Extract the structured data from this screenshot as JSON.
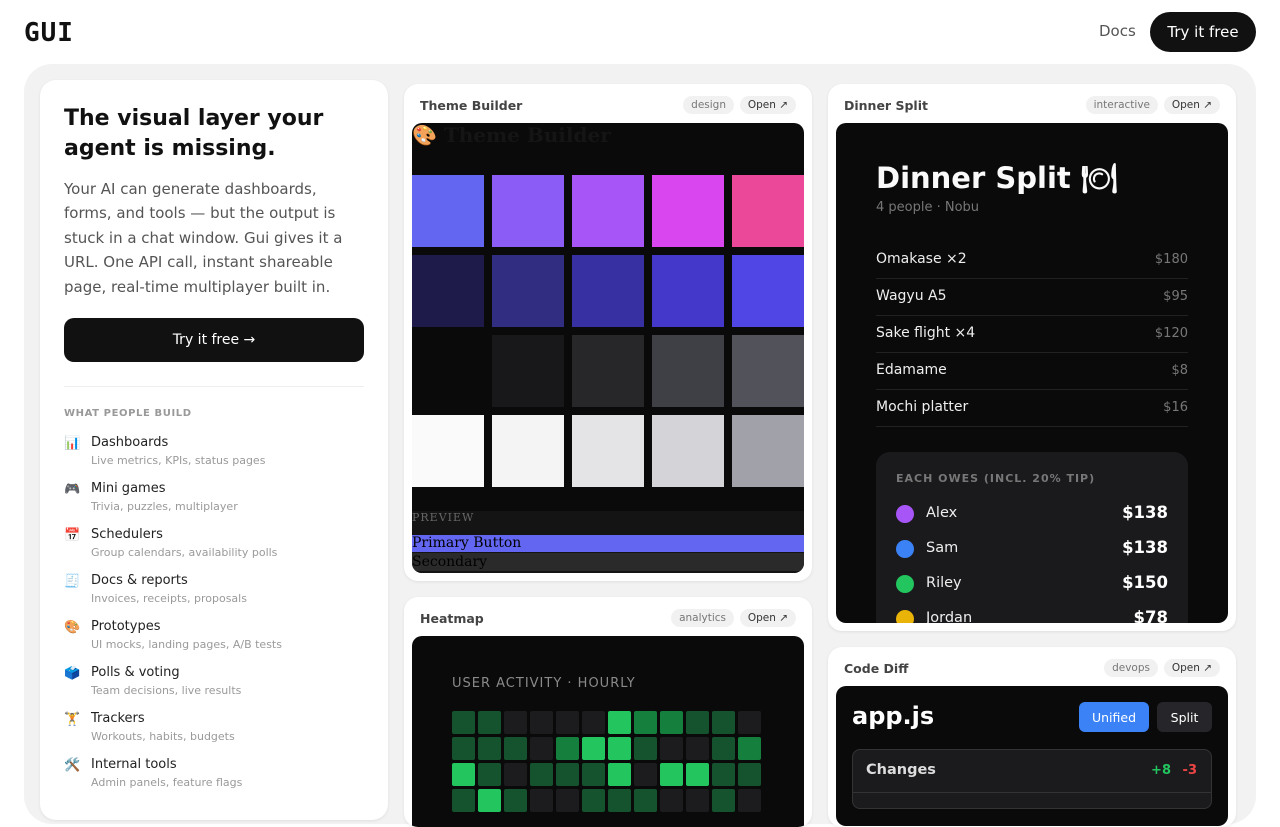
{
  "nav": {
    "logo": "GUI",
    "docs_label": "Docs",
    "try_label": "Try it free"
  },
  "hero": {
    "title": "The visual layer your agent is missing.",
    "description": "Your AI can generate dashboards, forms, and tools — but the output is stuck in a chat window. Gui gives it a URL. One API call, instant shareable page, real-time multiplayer built in.",
    "cta_label": "Try it free →",
    "build_heading": "WHAT PEOPLE BUILD",
    "items": [
      {
        "icon": "📊",
        "icon_name": "bar-chart-icon",
        "label": "Dashboards",
        "sub": "Live metrics, KPIs, status pages"
      },
      {
        "icon": "🎮",
        "icon_name": "game-controller-icon",
        "label": "Mini games",
        "sub": "Trivia, puzzles, multiplayer"
      },
      {
        "icon": "📅",
        "icon_name": "calendar-icon",
        "label": "Schedulers",
        "sub": "Group calendars, availability polls"
      },
      {
        "icon": "🧾",
        "icon_name": "receipt-icon",
        "label": "Docs & reports",
        "sub": "Invoices, receipts, proposals"
      },
      {
        "icon": "🎨",
        "icon_name": "palette-icon",
        "label": "Prototypes",
        "sub": "UI mocks, landing pages, A/B tests"
      },
      {
        "icon": "🗳️",
        "icon_name": "ballot-box-icon",
        "label": "Polls & voting",
        "sub": "Team decisions, live results"
      },
      {
        "icon": "🏋️",
        "icon_name": "weightlifter-icon",
        "label": "Trackers",
        "sub": "Workouts, habits, budgets"
      },
      {
        "icon": "🛠️",
        "icon_name": "tools-icon",
        "label": "Internal tools",
        "sub": "Admin panels, feature flags"
      }
    ]
  },
  "cards": {
    "theme": {
      "title": "Theme Builder",
      "tag": "design",
      "open_label": "Open ↗",
      "heading": "🎨 Theme Builder",
      "swatch_rows": [
        [
          "#6366f1",
          "#8b5cf6",
          "#a855f7",
          "#d946ef",
          "#ec4899"
        ],
        [
          "#1e1b4b",
          "#312e81",
          "#3730a3",
          "#4338ca",
          "#4f46e5"
        ],
        [
          "#0a0a0a",
          "#18181b",
          "#27272a",
          "#3f3f46",
          "#52525b"
        ],
        [
          "#fafafa",
          "#f4f4f5",
          "#e4e4e7",
          "#d4d4d8",
          "#a1a1aa"
        ]
      ],
      "preview_label": "PREVIEW",
      "primary_label": "Primary Button",
      "secondary_label": "Secondary"
    },
    "heatmap": {
      "title": "Heatmap",
      "tag": "analytics",
      "open_label": "Open ↗",
      "chart_title": "USER ACTIVITY · HOURLY",
      "levels": [
        [
          1,
          1,
          0,
          0,
          0,
          0,
          3,
          2,
          2,
          1,
          1,
          0
        ],
        [
          1,
          1,
          1,
          0,
          2,
          3,
          3,
          1,
          0,
          0,
          1,
          2
        ],
        [
          3,
          1,
          0,
          1,
          1,
          1,
          3,
          0,
          3,
          3,
          1,
          1
        ],
        [
          1,
          3,
          1,
          0,
          0,
          1,
          1,
          1,
          0,
          0,
          1,
          0
        ]
      ],
      "level_colors": [
        "#1c1c1f",
        "#14532d",
        "#15803d",
        "#22c55e"
      ]
    },
    "dinner": {
      "title": "Dinner Split",
      "tag": "interactive",
      "open_label": "Open ↗",
      "heading": "Dinner Split 🍽",
      "subtitle": "4 people · Nobu",
      "items": [
        {
          "name": "Omakase ×2",
          "price": "$180"
        },
        {
          "name": "Wagyu A5",
          "price": "$95"
        },
        {
          "name": "Sake flight ×4",
          "price": "$120"
        },
        {
          "name": "Edamame",
          "price": "$8"
        },
        {
          "name": "Mochi platter",
          "price": "$16"
        }
      ],
      "owes_title": "EACH OWES (INCL. 20% TIP)",
      "people": [
        {
          "name": "Alex",
          "amount": "$138",
          "color": "#a855f7"
        },
        {
          "name": "Sam",
          "amount": "$138",
          "color": "#3b82f6"
        },
        {
          "name": "Riley",
          "amount": "$150",
          "color": "#22c55e"
        },
        {
          "name": "Jordan",
          "amount": "$78",
          "color": "#eab308"
        }
      ]
    },
    "diff": {
      "title": "Code Diff",
      "tag": "devops",
      "open_label": "Open ↗",
      "filename": "app.js",
      "unified_label": "Unified",
      "split_label": "Split",
      "changes_label": "Changes",
      "additions": "+8",
      "deletions": "-3"
    }
  }
}
